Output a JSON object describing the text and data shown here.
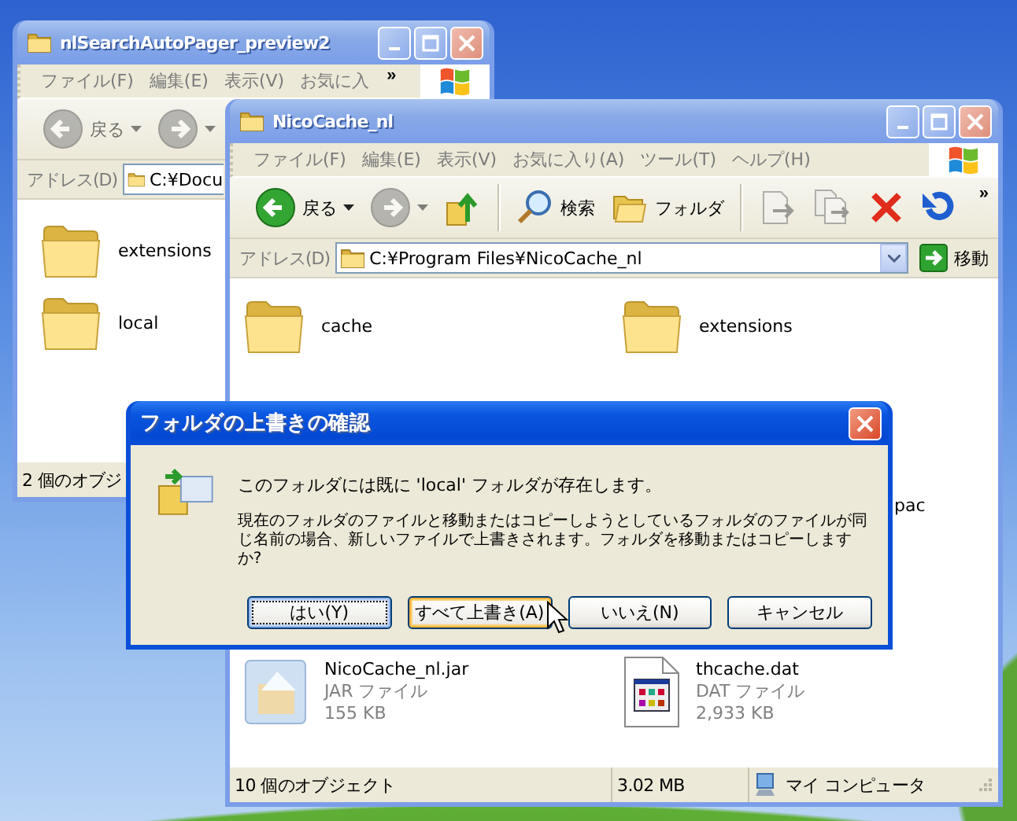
{
  "windows": [
    {
      "title": "nlSearchAutoPager_preview2",
      "active": false,
      "menu": [
        "ファイル(F)",
        "編集(E)",
        "表示(V)",
        "お気に入"
      ],
      "menu_overflow": "»",
      "toolbar_groups": [
        [
          {
            "kind": "back",
            "label": "戻る",
            "disabled": true
          },
          {
            "kind": "forward",
            "disabled": true
          }
        ]
      ],
      "address_label": "アドレス(D)",
      "address": "C:¥Docu",
      "item_rows": [
        [
          {
            "kind": "folder",
            "name": "extensions"
          }
        ],
        [
          {
            "kind": "folder",
            "name": "local"
          }
        ]
      ],
      "status": [
        {
          "kind": "text",
          "text": "2 個のオブジ"
        }
      ]
    },
    {
      "title": "NicoCache_nl",
      "active": false,
      "menu": [
        "ファイル(F)",
        "編集(E)",
        "表示(V)",
        "お気に入り(A)",
        "ツール(T)",
        "ヘルプ(H)"
      ],
      "toolbar_groups": [
        [
          {
            "kind": "back",
            "label": "戻る",
            "disabled": false
          },
          {
            "kind": "forward",
            "disabled": true
          },
          {
            "kind": "up",
            "disabled": false
          }
        ],
        [
          {
            "kind": "search",
            "label": "検索",
            "disabled": false
          },
          {
            "kind": "folders",
            "label": "フォルダ",
            "disabled": false
          }
        ],
        [
          {
            "kind": "move",
            "disabled": true
          },
          {
            "kind": "copy",
            "disabled": true
          },
          {
            "kind": "delete",
            "disabled": false
          },
          {
            "kind": "undo",
            "disabled": false
          }
        ]
      ],
      "toolbar_overflow": "»",
      "address_label": "アドレス(D)",
      "address": "C:¥Program Files¥NicoCache_nl",
      "go_label": "移動",
      "item_rows": [
        [
          {
            "kind": "folder",
            "name": "cache"
          },
          {
            "kind": "folder",
            "name": "extensions"
          }
        ],
        [
          {
            "kind": "jar",
            "name": "NicoCache_nl.jar",
            "type": "JAR ファイル",
            "size": "155 KB"
          },
          {
            "kind": "dat",
            "name": "thcache.dat",
            "type": "DAT ファイル",
            "size": "2,933 KB"
          }
        ]
      ],
      "covered_label": "pac",
      "status": [
        {
          "kind": "text",
          "text": "10 個のオブジェクト"
        },
        {
          "kind": "size",
          "text": "3.02 MB"
        },
        {
          "kind": "zone",
          "text": "マイ コンピュータ"
        }
      ]
    }
  ],
  "dialog": {
    "title": "フォルダの上書きの確認",
    "active": true,
    "message": "このフォルダには既に 'local' フォルダが存在します。",
    "detail": "現在のフォルダのファイルと移動またはコピーしようとしているフォルダのファイルが同じ名前の場合、新しいファイルで上書きされます。フォルダを移動またはコピーしますか?",
    "buttons": [
      {
        "label": "はい(Y)",
        "default": true,
        "hovered": false
      },
      {
        "label": "すべて上書き(A)",
        "default": false,
        "hovered": true
      },
      {
        "label": "いいえ(N)",
        "default": false,
        "hovered": false
      },
      {
        "label": "キャンセル",
        "default": false,
        "hovered": false
      }
    ]
  }
}
